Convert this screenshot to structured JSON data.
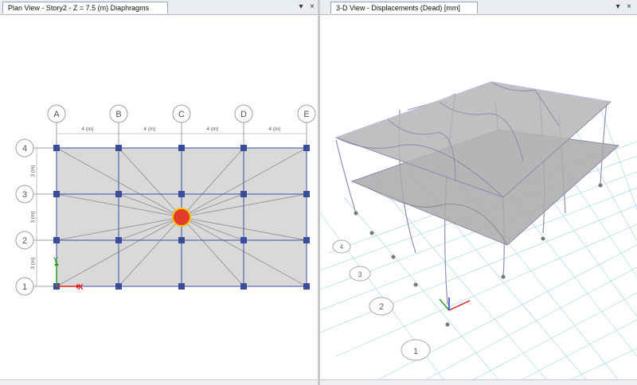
{
  "left_view": {
    "title": "Plan View - Story2 - Z = 7.5 (m)  Diaphragms",
    "dropdown_icon": "triangle-down-icon",
    "close_icon": "close-x-icon",
    "grid_columns": [
      "A",
      "B",
      "C",
      "D",
      "E"
    ],
    "grid_rows": [
      "1",
      "2",
      "3",
      "4"
    ],
    "x_spacing_label": "4 (m)",
    "y_spacing_label": "3 (m)",
    "axis_x_label": "X",
    "axis_y_label": "Y"
  },
  "right_view": {
    "title": "3-D View  - Displacements (Dead)  [mm]",
    "dropdown_icon": "triangle-down-icon",
    "close_icon": "close-x-icon",
    "grid_rows": [
      "1",
      "2",
      "3",
      "4"
    ]
  },
  "colors": {
    "grid_line": "#3b4ea3",
    "column_node": "#3a4d99",
    "slab_fill": "#d9d9d9",
    "diaphragm_center": "#e23a2b",
    "diaphragm_outline": "#f0c400",
    "axis_x": "#e02020",
    "axis_y": "#22a020",
    "axis_z": "#2040d0"
  }
}
